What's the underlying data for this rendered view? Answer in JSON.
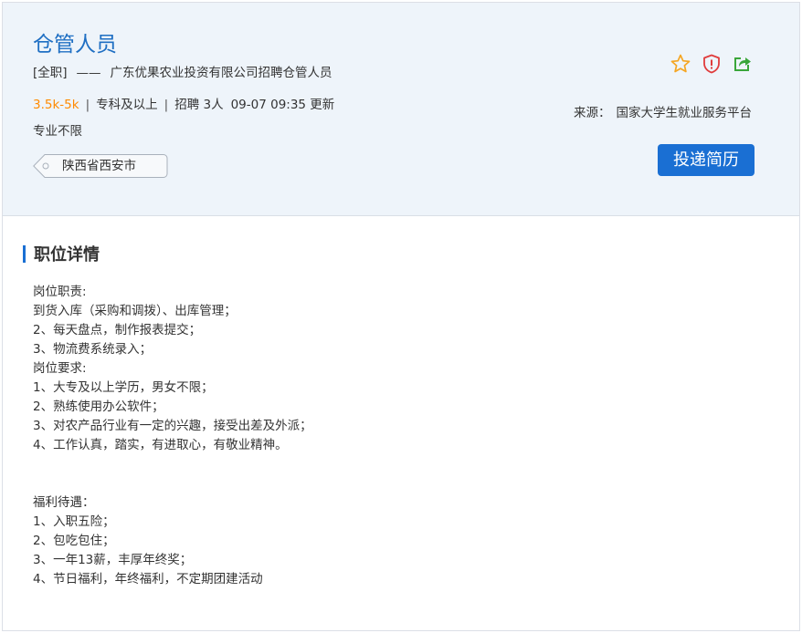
{
  "job": {
    "title": "仓管人员",
    "type": "[全职]",
    "dash": "——",
    "company_line": "广东优果农业投资有限公司招聘仓管人员",
    "salary": "3.5k-5k",
    "separator": "|",
    "education": "专科及以上",
    "headcount": "招聘 3人",
    "updated": "09-07 09:35 更新",
    "major": "专业不限",
    "location": "陕西省西安市"
  },
  "actions": {
    "icons": [
      "star-icon",
      "shield-report-icon",
      "share-icon"
    ],
    "source_label": "来源：",
    "source_value": "国家大学生就业服务平台",
    "apply_label": "投递简历"
  },
  "colors": {
    "title": "#1f6fc3",
    "salary": "#ff8a00",
    "primary": "#1a6fd3",
    "header_bg": "#eef4fa",
    "star": "#f5a623",
    "shield": "#e03c3c",
    "share": "#3aa63a"
  },
  "details": {
    "heading": "职位详情",
    "lines": [
      "岗位职责:",
      "到货入库（采购和调拨）、出库管理；",
      "2、每天盘点，制作报表提交；",
      "3、物流费系统录入；",
      "岗位要求:",
      "1、大专及以上学历，男女不限；",
      "2、熟练使用办公软件；",
      "3、对农产品行业有一定的兴趣，接受出差及外派；",
      "4、工作认真，踏实，有进取心，有敬业精神。",
      "",
      "",
      "福利待遇：",
      "1、入职五险；",
      "2、包吃包住；",
      "3、一年13薪，丰厚年终奖；",
      "4、节日福利，年终福利，不定期团建活动"
    ]
  }
}
